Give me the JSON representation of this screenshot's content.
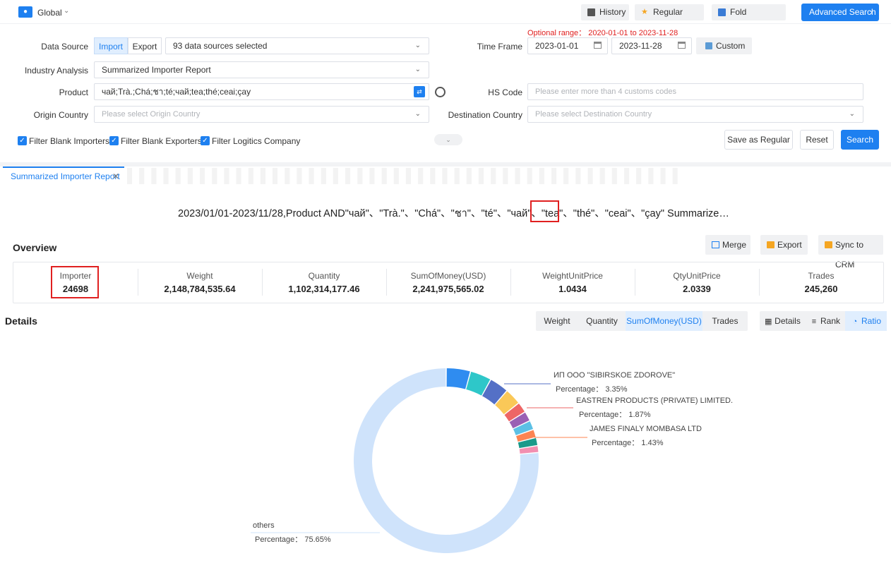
{
  "topbar": {
    "region": "Global",
    "history": "History",
    "regular_cond": "Regular Cond.",
    "fold_conditions": "Fold Conditions",
    "advanced_search": "Advanced Search"
  },
  "filters": {
    "optional_range": "Optional range： 2020-01-01 to 2023-11-28",
    "data_source_label": "Data Source",
    "import_label": "Import",
    "export_label": "Export",
    "data_sources_value": "93 data sources selected",
    "time_frame_label": "Time Frame",
    "date_from": "2023-01-01",
    "date_to": "2023-11-28",
    "custom_label": "Custom",
    "industry_label": "Industry Analysis",
    "industry_value": "Summarized Importer Report",
    "product_label": "Product",
    "product_value": "чай;Trà.;Chá;ชา;té;чай;tea;thé;ceai;çay",
    "hs_code_label": "HS Code",
    "hs_code_placeholder": "Please enter more than 4 customs codes",
    "origin_label": "Origin Country",
    "origin_placeholder": "Please select Origin Country",
    "destination_label": "Destination Country",
    "destination_placeholder": "Please select Destination Country",
    "filter_blank_importers": "Filter Blank Importers",
    "filter_blank_exporters": "Filter Blank Exporters",
    "filter_logistics": "Filter Logitics Company",
    "save_regular": "Save as Regular",
    "reset": "Reset",
    "search": "Search"
  },
  "report": {
    "tab_label": "Summarized Importer Report",
    "query_title": "2023/01/01-2023/11/28,Product AND\"чай\"、\"Trà.\"、\"Chá\"、\"ชา\"、\"té\"、\"чай\"、\"tea\"、\"thé\"、\"ceai\"、\"çay\" Summarize…",
    "overview_title": "Overview",
    "merge": "Merge",
    "export": "Export",
    "sync_crm": "Sync to CRM"
  },
  "stats": [
    {
      "label": "Importer",
      "value": "24698"
    },
    {
      "label": "Weight",
      "value": "2,148,784,535.64"
    },
    {
      "label": "Quantity",
      "value": "1,102,314,177.46"
    },
    {
      "label": "SumOfMoney(USD)",
      "value": "2,241,975,565.02"
    },
    {
      "label": "WeightUnitPrice",
      "value": "1.0434"
    },
    {
      "label": "QtyUnitPrice",
      "value": "2.0339"
    },
    {
      "label": "Trades",
      "value": "245,260"
    }
  ],
  "details": {
    "title": "Details",
    "metric_tabs": [
      "Weight",
      "Quantity",
      "SumOfMoney(USD)",
      "Trades"
    ],
    "active_metric": "SumOfMoney(USD)",
    "view_tabs": [
      "Details",
      "Rank",
      "Ratio"
    ],
    "active_view": "Ratio"
  },
  "chart_data": {
    "type": "pie",
    "style": "donut",
    "metric": "SumOfMoney(USD)",
    "percentage_prefix": "Percentage：",
    "labeled_slices": [
      {
        "name": "ИП ООО \"SIBIRSKOE ZDOROVE\"",
        "percentage": "3.35%",
        "value": 3.35,
        "color": "#5470c6"
      },
      {
        "name": "EASTREN PRODUCTS (PRIVATE) LIMITED.",
        "percentage": "1.87%",
        "value": 1.87,
        "color": "#ee6666"
      },
      {
        "name": "JAMES FINALY MOMBASA LTD",
        "percentage": "1.43%",
        "value": 1.43,
        "color": "#fc8452"
      },
      {
        "name": "others",
        "percentage": "75.65%",
        "value": 75.65,
        "color": "#cfe3fb"
      }
    ],
    "slices": [
      {
        "value": 4.2,
        "color": "#2f8cf0"
      },
      {
        "value": 3.7,
        "color": "#2ec7c9"
      },
      {
        "value": 3.35,
        "color": "#5470c6"
      },
      {
        "value": 2.9,
        "color": "#fac858"
      },
      {
        "value": 1.87,
        "color": "#ee6666"
      },
      {
        "value": 1.7,
        "color": "#9a60b4"
      },
      {
        "value": 1.6,
        "color": "#5cc0e5"
      },
      {
        "value": 1.43,
        "color": "#fc8452"
      },
      {
        "value": 1.4,
        "color": "#1a9a8a"
      },
      {
        "value": 1.2,
        "color": "#f28fb0"
      },
      {
        "value": 75.65,
        "color": "#cfe3fb"
      }
    ]
  }
}
